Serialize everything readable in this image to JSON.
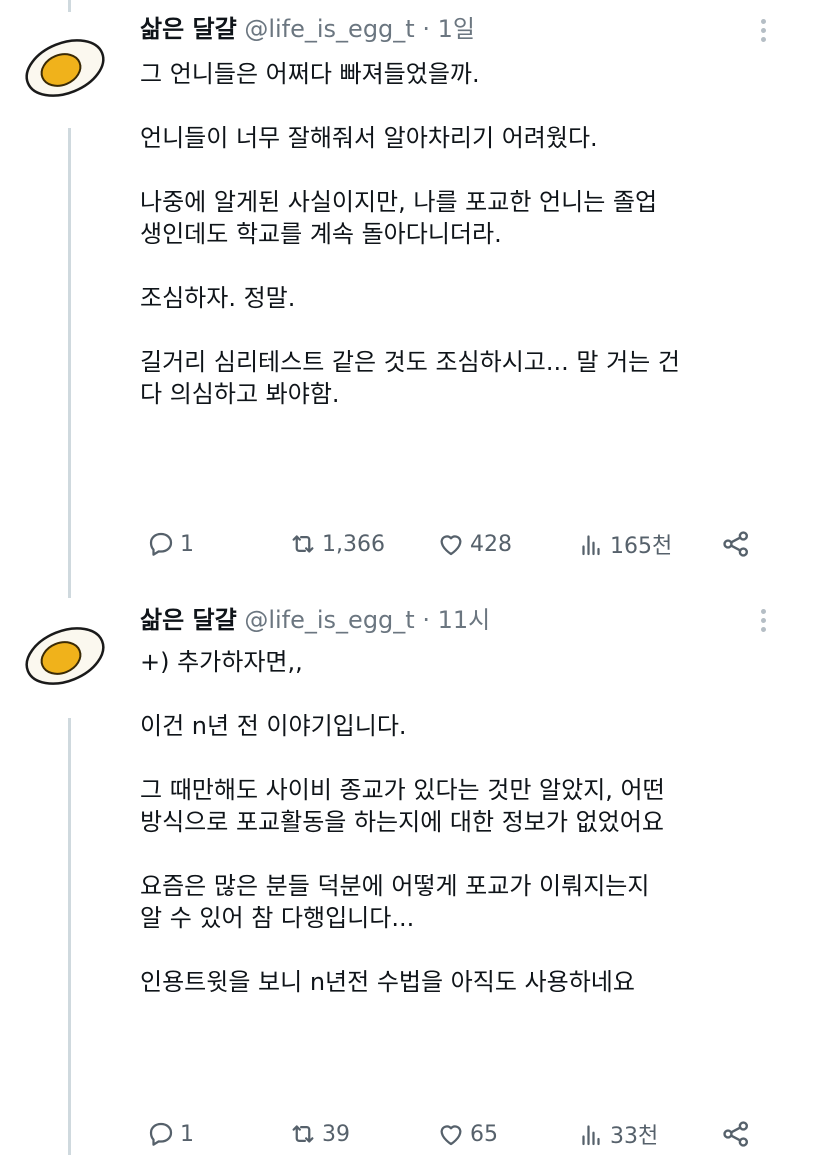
{
  "tweets": [
    {
      "name": "삶은 달걀",
      "handle": "@life_is_egg_t",
      "dot": "·",
      "time": "1일",
      "lines": [
        "그 언니들은 어쩌다 빠져들었을까.",
        "",
        "언니들이 너무 잘해줘서 알아차리기 어려웠다.",
        "",
        "나중에 알게된 사실이지만, 나를 포교한 언니는 졸업",
        "생인데도 학교를 계속 돌아다니더라.",
        "",
        "조심하자. 정말.",
        "",
        "길거리 심리테스트 같은 것도 조심하시고... 말 거는 건",
        "다 의심하고 봐야함."
      ],
      "replies": "1",
      "retweets": "1,366",
      "likes": "428",
      "views": "165천"
    },
    {
      "name": "삶은 달걀",
      "handle": "@life_is_egg_t",
      "dot": "·",
      "time": "11시",
      "lines": [
        "+) 추가하자면,,",
        "",
        "이건 n년 전 이야기입니다.",
        "",
        "그 때만해도 사이비 종교가 있다는 것만 알았지, 어떤",
        "방식으로 포교활동을 하는지에 대한 정보가 없었어요",
        "",
        "요즘은 많은 분들 덕분에 어떻게 포교가 이뤄지는지",
        "알 수 있어 참 다행입니다...",
        "",
        "인용트윗을 보니 n년전 수법을 아직도 사용하네요"
      ],
      "replies": "1",
      "retweets": "39",
      "likes": "65",
      "views": "33천"
    }
  ],
  "icons": {
    "reply": "reply-icon",
    "retweet": "retweet-icon",
    "like": "heart-icon",
    "views": "views-icon",
    "share": "share-icon",
    "more": "more-icon",
    "avatar": "boiled-egg-avatar"
  },
  "colors": {
    "text": "#0f1419",
    "secondary": "#6b7680",
    "thread_line": "#cfd9de",
    "egg_yolk": "#f0b21b"
  }
}
